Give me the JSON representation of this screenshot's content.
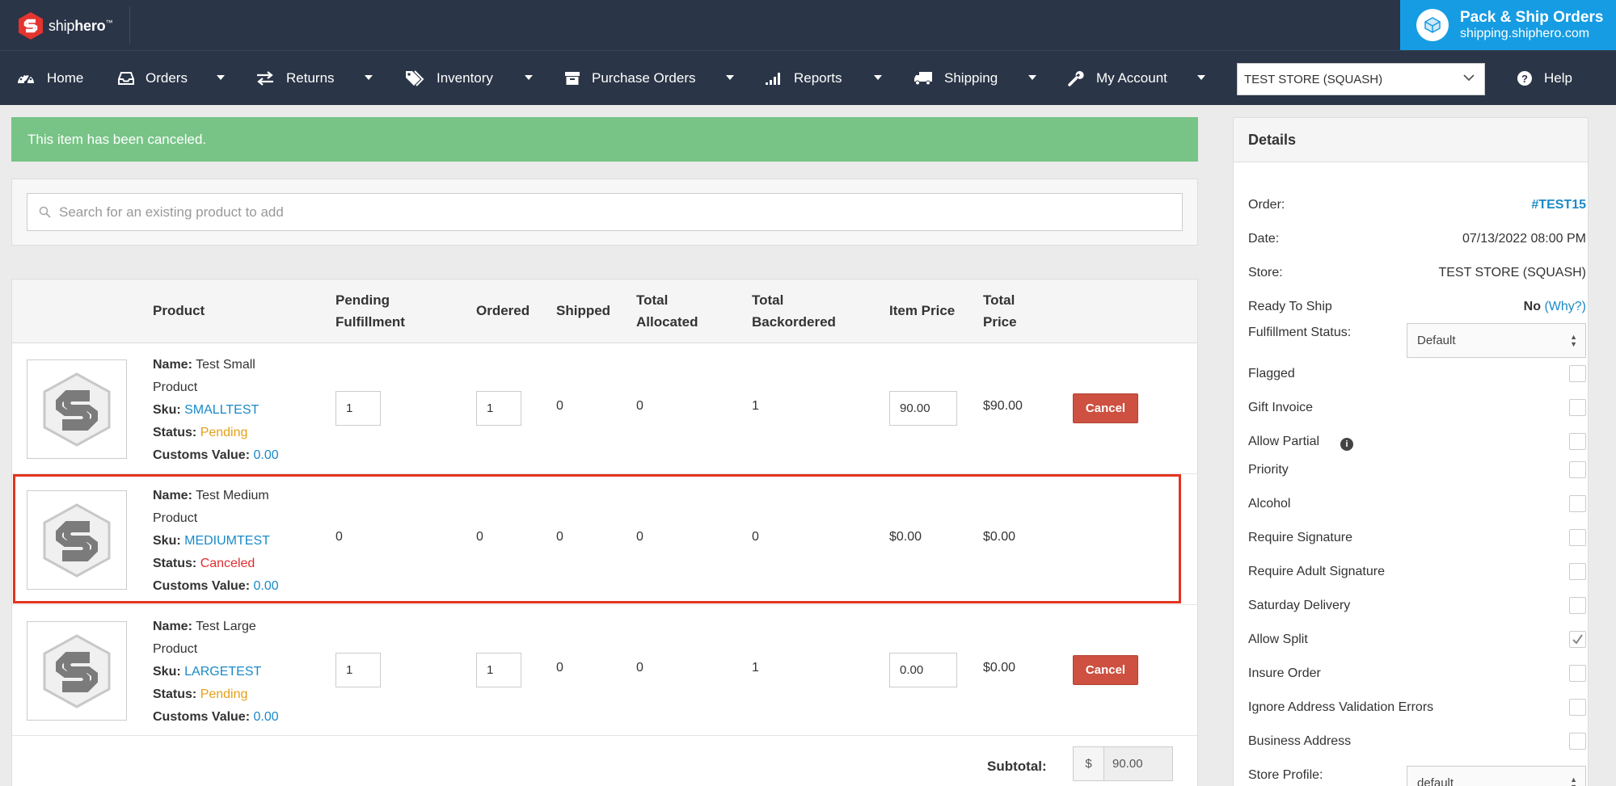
{
  "brand": {
    "logo_bold": "ship",
    "logo_rest": "hero",
    "tm": "™"
  },
  "pack_banner": {
    "title": "Pack & Ship Orders",
    "subtitle": "shipping.shiphero.com"
  },
  "nav": {
    "items": [
      {
        "label": "Home",
        "icon": "dashboard-icon"
      },
      {
        "label": "Orders",
        "icon": "inbox-icon"
      },
      {
        "label": "Returns",
        "icon": "exchange-arrows-icon"
      },
      {
        "label": "Inventory",
        "icon": "tags-icon"
      },
      {
        "label": "Purchase Orders",
        "icon": "archive-box-icon"
      },
      {
        "label": "Reports",
        "icon": "signal-bars-icon"
      },
      {
        "label": "Shipping",
        "icon": "truck-icon"
      },
      {
        "label": "My Account",
        "icon": "wrench-icon"
      }
    ],
    "store_select": "TEST STORE (SQUASH)",
    "help": "Help"
  },
  "alert": "This item has been canceled.",
  "search": {
    "placeholder": "Search for an existing product to add"
  },
  "table": {
    "headers": {
      "product": "Product",
      "pending_1": "Pending",
      "pending_2": "Fulfillment",
      "ordered": "Ordered",
      "shipped": "Shipped",
      "allocated_1": "Total",
      "allocated_2": "Allocated",
      "backordered_1": "Total",
      "backordered_2": "Backordered",
      "item_price": "Item Price",
      "total_price_1": "Total",
      "total_price_2": "Price"
    },
    "labels": {
      "name": "Name:",
      "sku": "Sku:",
      "status": "Status:",
      "customs": "Customs Value:"
    },
    "rows": [
      {
        "name_1": "Test Small",
        "name_2": "Product",
        "sku": "SMALLTEST",
        "status": "Pending",
        "customs": "0.00",
        "pending": "1",
        "ordered": "1",
        "shipped": "0",
        "allocated": "0",
        "backordered": "1",
        "item_price": "90.00",
        "total_price": "$90.00",
        "cancel": "Cancel"
      },
      {
        "name_1": "Test Medium",
        "name_2": "Product",
        "sku": "MEDIUMTEST",
        "status": "Canceled",
        "customs": "0.00",
        "pending": "0",
        "ordered": "0",
        "shipped": "0",
        "allocated": "0",
        "backordered": "0",
        "item_price": "$0.00",
        "total_price": "$0.00"
      },
      {
        "name_1": "Test Large",
        "name_2": "Product",
        "sku": "LARGETEST",
        "status": "Pending",
        "customs": "0.00",
        "pending": "1",
        "ordered": "1",
        "shipped": "0",
        "allocated": "0",
        "backordered": "1",
        "item_price": "0.00",
        "total_price": "$0.00",
        "cancel": "Cancel"
      }
    ],
    "subtotal_label": "Subtotal:",
    "subtotal_currency": "$",
    "subtotal_value": "90.00"
  },
  "details": {
    "title": "Details",
    "order_label": "Order:",
    "order_value": "#TEST15",
    "date_label": "Date:",
    "date_value": "07/13/2022 08:00 PM",
    "store_label": "Store:",
    "store_value": "TEST STORE (SQUASH)",
    "ready_label": "Ready To Ship",
    "ready_value": "No",
    "ready_why": "(Why?)",
    "fulfillment_label": "Fulfillment Status:",
    "fulfillment_value": "Default",
    "checkboxes": [
      {
        "label": "Flagged",
        "checked": false
      },
      {
        "label": "Gift Invoice",
        "checked": false
      },
      {
        "label": "Allow Partial",
        "checked": false
      },
      {
        "label": "Priority",
        "checked": false
      },
      {
        "label": "Alcohol",
        "checked": false
      },
      {
        "label": "Require Signature",
        "checked": false
      },
      {
        "label": "Require Adult Signature",
        "checked": false
      },
      {
        "label": "Saturday Delivery",
        "checked": false
      },
      {
        "label": "Allow Split",
        "checked": true
      },
      {
        "label": "Insure Order",
        "checked": false
      },
      {
        "label": "Ignore Address Validation Errors",
        "checked": false
      },
      {
        "label": "Business Address",
        "checked": false
      }
    ],
    "profile_label": "Store Profile:",
    "profile_value": "default"
  },
  "colors": {
    "navbar": "#2a3547",
    "banner": "#169ce3",
    "alert": "#77c486",
    "link": "#1a8ac7",
    "pending": "#e59f16",
    "canceled": "#e02f2f",
    "cancel_button": "#cd5040",
    "highlight": "#e3341e"
  }
}
